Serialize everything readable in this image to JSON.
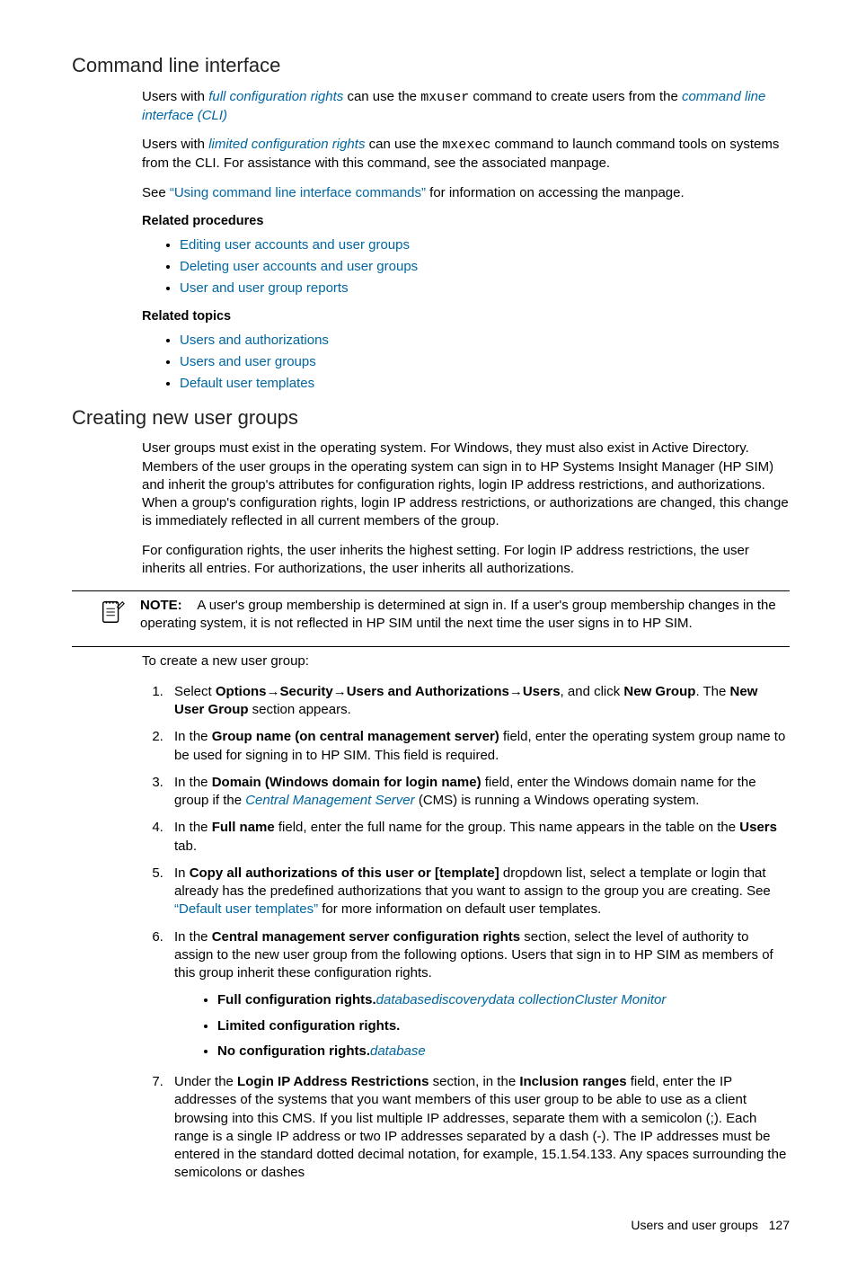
{
  "section1": {
    "heading": "Command line interface",
    "p1_a": "Users with ",
    "p1_link1": "full configuration rights",
    "p1_b": " can use the ",
    "p1_cmd": "mxuser",
    "p1_c": " command to create users from the ",
    "p1_link2": "command line interface (CLI)",
    "p2_a": "Users with ",
    "p2_link1": "limited configuration rights",
    "p2_b": " can use the ",
    "p2_cmd": "mxexec",
    "p2_c": " command to launch command tools on systems from the CLI. For assistance with this command, see the associated manpage.",
    "p3_a": "See ",
    "p3_link": "“Using command line interface commands”",
    "p3_b": " for information on accessing the manpage.",
    "related_procedures_label": "Related procedures",
    "procs": [
      "Editing user accounts and user groups",
      "Deleting user accounts and user groups",
      "User and user group reports"
    ],
    "related_topics_label": "Related topics",
    "topics": [
      "Users and authorizations",
      "Users and user groups",
      "Default user templates"
    ]
  },
  "section2": {
    "heading": "Creating new user groups",
    "p1": "User groups must exist in the operating system. For Windows, they must also exist in Active Directory. Members of the user groups in the operating system can sign in to HP Systems Insight Manager (HP SIM) and inherit the group's attributes for configuration rights, login IP address restrictions, and authorizations. When a group's configuration rights, login IP address restrictions, or authorizations are changed, this change is immediately reflected in all current members of the group.",
    "p2": "For configuration rights, the user inherits the highest setting. For login IP address restrictions, the user inherits all entries. For authorizations, the user inherits all authorizations.",
    "note_label": "NOTE:",
    "note_text": "A user's group membership is determined at sign in. If a user's group membership changes in the operating system, it is not reflected in HP SIM until the next time the user signs in to HP SIM.",
    "intro": "To create a new user group:",
    "steps": {
      "s1_a": "Select ",
      "s1_path": "Options→Security→Users and Authorizations→Users",
      "s1_b": ", and click ",
      "s1_c": "New Group",
      "s1_d": ". The ",
      "s1_e": "New User Group",
      "s1_f": " section appears.",
      "s2_a": "In the ",
      "s2_b": "Group name (on central management server)",
      "s2_c": " field, enter the operating system group name to be used for signing in to HP SIM. This field is required.",
      "s3_a": "In the ",
      "s3_b": "Domain (Windows domain for login name)",
      "s3_c": " field, enter the Windows domain name for the group if the ",
      "s3_link": "Central Management Server",
      "s3_d": " (CMS) is running a Windows operating system.",
      "s4_a": "In the ",
      "s4_b": "Full name",
      "s4_c": " field, enter the full name for the group. This name appears in the table on the ",
      "s4_d": "Users",
      "s4_e": " tab.",
      "s5_a": "In ",
      "s5_b": "Copy all authorizations of this user or [template]",
      "s5_c": " dropdown list, select a template or login that already has the predefined authorizations that you want to assign to the group you are creating. See ",
      "s5_link": "“Default user templates”",
      "s5_d": " for more information on default user templates.",
      "s6_a": "In the ",
      "s6_b": "Central management server configuration rights",
      "s6_c": " section, select the level of authority to assign to the new user group from the following options. Users that sign in to HP SIM as members of this group inherit these configuration rights.",
      "s6_opts": {
        "o1_b": "Full configuration rights.",
        "o1_i": "databasediscoverydata collectionCluster Monitor",
        "o2_b": "Limited configuration rights.",
        "o3_b": "No configuration rights.",
        "o3_i": "database"
      },
      "s7_a": "Under the ",
      "s7_b": "Login IP Address Restrictions",
      "s7_c": " section, in the ",
      "s7_d": "Inclusion ranges",
      "s7_e": " field, enter the IP addresses of the systems that you want members of this user group to be able to use as a client browsing into this CMS. If you list multiple IP addresses, separate them with a semicolon (;). Each range is a single IP address or two IP addresses separated by a dash (-). The IP addresses must be entered in the standard dotted decimal notation, for example, 15.1.54.133. Any spaces surrounding the semicolons or dashes"
    }
  },
  "footer": {
    "label": "Users and user groups",
    "page": "127"
  }
}
